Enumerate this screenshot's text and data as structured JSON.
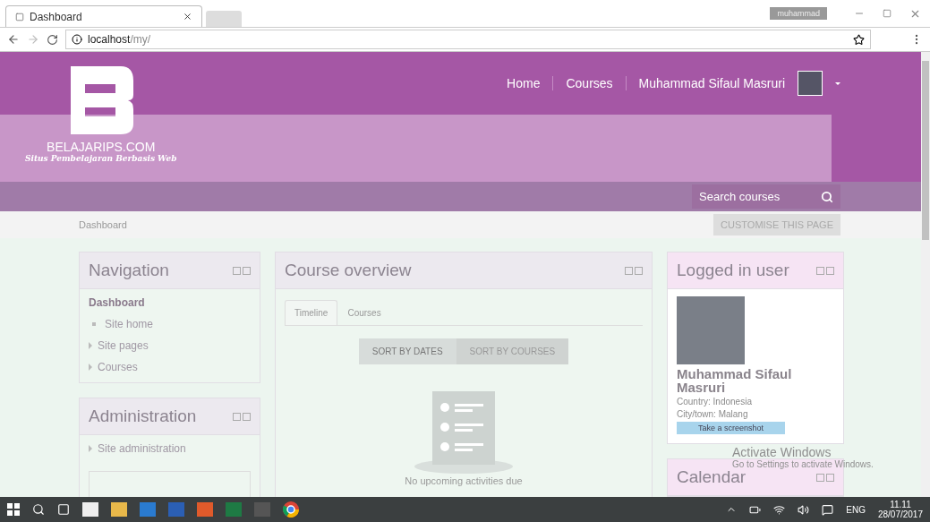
{
  "browser": {
    "tab": {
      "title": "Dashboard"
    },
    "profile_badge": "muhammad",
    "address": {
      "host": "localhost",
      "path": "/my/"
    }
  },
  "header": {
    "site_name": "BELAJARIPS.COM",
    "tagline": "Situs Pembelajaran Berbasis Web",
    "nav": [
      {
        "label": "Home"
      },
      {
        "label": "Courses"
      }
    ],
    "user_name": "Muhammad Sifaul Masruri",
    "search": {
      "placeholder": "Search courses"
    }
  },
  "breadcrumb": "Dashboard",
  "customise_button": "CUSTOMISE THIS PAGE",
  "navigation": {
    "title": "Navigation",
    "items": [
      {
        "label": "Dashboard",
        "kind": "current"
      },
      {
        "label": "Site home",
        "kind": "leaf"
      },
      {
        "label": "Site pages",
        "kind": "branch"
      },
      {
        "label": "Courses",
        "kind": "branch"
      }
    ]
  },
  "administration": {
    "title": "Administration",
    "items": [
      {
        "label": "Site administration",
        "kind": "branch"
      }
    ]
  },
  "course_overview": {
    "title": "Course overview",
    "tabs": [
      {
        "label": "Timeline",
        "selected": true
      },
      {
        "label": "Courses",
        "selected": false
      }
    ],
    "sort_buttons": [
      {
        "label": "SORT BY DATES",
        "selected": true
      },
      {
        "label": "SORT BY COURSES",
        "selected": false
      }
    ],
    "empty_message": "No upcoming activities due"
  },
  "logged_in_user": {
    "title": "Logged in user",
    "name": "Muhammad Sifaul Masruri",
    "country": "Country: Indonesia",
    "city": "City/town: Malang",
    "tooltip": "Take a screenshot"
  },
  "calendar": {
    "title": "Calendar"
  },
  "activation": {
    "title": "Activate Windows",
    "subtitle": "Go to Settings to activate Windows."
  },
  "taskbar": {
    "language": "ENG",
    "time": "11.11",
    "date": "28/07/2017"
  }
}
